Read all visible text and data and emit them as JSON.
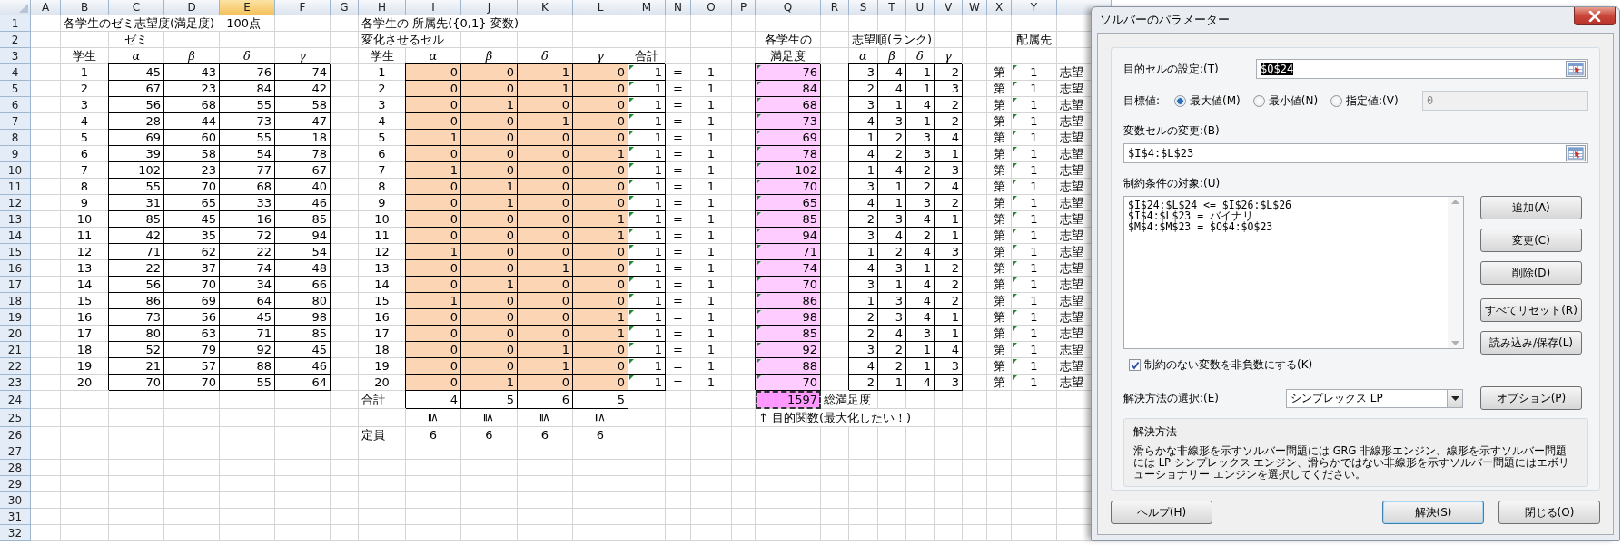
{
  "sheet": {
    "columns": [
      {
        "label": "A",
        "selected": false
      },
      {
        "label": "B",
        "selected": false
      },
      {
        "label": "C",
        "selected": false
      },
      {
        "label": "D",
        "selected": false
      },
      {
        "label": "E",
        "selected": true
      },
      {
        "label": "F",
        "selected": false
      },
      {
        "label": "G",
        "selected": false
      },
      {
        "label": "H",
        "selected": false
      },
      {
        "label": "I",
        "selected": false
      },
      {
        "label": "J",
        "selected": false
      },
      {
        "label": "K",
        "selected": false
      },
      {
        "label": "L",
        "selected": false
      },
      {
        "label": "M",
        "selected": false
      },
      {
        "label": "N",
        "selected": false
      },
      {
        "label": "O",
        "selected": false
      },
      {
        "label": "P",
        "selected": false
      },
      {
        "label": "Q",
        "selected": false
      },
      {
        "label": "R",
        "selected": false
      },
      {
        "label": "S",
        "selected": false
      },
      {
        "label": "T",
        "selected": false
      },
      {
        "label": "U",
        "selected": false
      },
      {
        "label": "V",
        "selected": false
      },
      {
        "label": "W",
        "selected": false
      },
      {
        "label": "X",
        "selected": false
      },
      {
        "label": "Y",
        "selected": false
      },
      {
        "selected": false
      }
    ],
    "rows": [
      "1",
      "2",
      "3",
      "4",
      "5",
      "6",
      "7",
      "8",
      "9",
      "10",
      "11",
      "12",
      "13",
      "14",
      "15",
      "16",
      "17",
      "18",
      "19",
      "20",
      "21",
      "22",
      "23",
      "24",
      "25",
      "26",
      "27",
      "28",
      "29",
      "30",
      "31",
      "32"
    ],
    "preferences": {
      "title": "各学生のゼミ志望度(満足度)　100点",
      "group": "ゼミ",
      "student_header": "学生",
      "zemi": [
        "α",
        "β",
        "δ",
        "γ"
      ],
      "rows": [
        {
          "student": "1",
          "scores": [
            "45",
            "43",
            "76",
            "74"
          ]
        },
        {
          "student": "2",
          "scores": [
            "67",
            "23",
            "84",
            "42"
          ]
        },
        {
          "student": "3",
          "scores": [
            "56",
            "68",
            "55",
            "58"
          ]
        },
        {
          "student": "4",
          "scores": [
            "28",
            "44",
            "73",
            "47"
          ]
        },
        {
          "student": "5",
          "scores": [
            "69",
            "60",
            "55",
            "18"
          ]
        },
        {
          "student": "6",
          "scores": [
            "39",
            "58",
            "54",
            "78"
          ]
        },
        {
          "student": "7",
          "scores": [
            "102",
            "23",
            "77",
            "67"
          ]
        },
        {
          "student": "8",
          "scores": [
            "55",
            "70",
            "68",
            "40"
          ]
        },
        {
          "student": "9",
          "scores": [
            "31",
            "65",
            "33",
            "46"
          ]
        },
        {
          "student": "10",
          "scores": [
            "85",
            "45",
            "16",
            "85"
          ]
        },
        {
          "student": "11",
          "scores": [
            "42",
            "35",
            "72",
            "94"
          ]
        },
        {
          "student": "12",
          "scores": [
            "71",
            "62",
            "22",
            "54"
          ]
        },
        {
          "student": "13",
          "scores": [
            "22",
            "37",
            "74",
            "48"
          ]
        },
        {
          "student": "14",
          "scores": [
            "56",
            "70",
            "34",
            "66"
          ]
        },
        {
          "student": "15",
          "scores": [
            "86",
            "69",
            "64",
            "80"
          ]
        },
        {
          "student": "16",
          "scores": [
            "73",
            "56",
            "45",
            "98"
          ]
        },
        {
          "student": "17",
          "scores": [
            "80",
            "63",
            "71",
            "85"
          ]
        },
        {
          "student": "18",
          "scores": [
            "52",
            "79",
            "92",
            "45"
          ]
        },
        {
          "student": "19",
          "scores": [
            "21",
            "57",
            "88",
            "46"
          ]
        },
        {
          "student": "20",
          "scores": [
            "70",
            "70",
            "55",
            "64"
          ]
        }
      ]
    },
    "assignment": {
      "title": "各学生の 所属先({0,1}-変数)",
      "subtitle": "変化させるセル",
      "student_header": "学生",
      "zemi": [
        "α",
        "β",
        "δ",
        "γ"
      ],
      "total_header": "合計",
      "total_flagged": true,
      "rows": [
        {
          "student": "1",
          "vars": [
            "0",
            "0",
            "1",
            "0"
          ],
          "total": "1",
          "relation": "=",
          "rhs": "1"
        },
        {
          "student": "2",
          "vars": [
            "0",
            "0",
            "1",
            "0"
          ],
          "total": "1",
          "relation": "=",
          "rhs": "1"
        },
        {
          "student": "3",
          "vars": [
            "0",
            "1",
            "0",
            "0"
          ],
          "total": "1",
          "relation": "=",
          "rhs": "1"
        },
        {
          "student": "4",
          "vars": [
            "0",
            "0",
            "1",
            "0"
          ],
          "total": "1",
          "relation": "=",
          "rhs": "1"
        },
        {
          "student": "5",
          "vars": [
            "1",
            "0",
            "0",
            "0"
          ],
          "total": "1",
          "relation": "=",
          "rhs": "1"
        },
        {
          "student": "6",
          "vars": [
            "0",
            "0",
            "0",
            "1"
          ],
          "total": "1",
          "relation": "=",
          "rhs": "1"
        },
        {
          "student": "7",
          "vars": [
            "1",
            "0",
            "0",
            "0"
          ],
          "total": "1",
          "relation": "=",
          "rhs": "1"
        },
        {
          "student": "8",
          "vars": [
            "0",
            "1",
            "0",
            "0"
          ],
          "total": "1",
          "relation": "=",
          "rhs": "1"
        },
        {
          "student": "9",
          "vars": [
            "0",
            "1",
            "0",
            "0"
          ],
          "total": "1",
          "relation": "=",
          "rhs": "1"
        },
        {
          "student": "10",
          "vars": [
            "0",
            "0",
            "0",
            "1"
          ],
          "total": "1",
          "relation": "=",
          "rhs": "1"
        },
        {
          "student": "11",
          "vars": [
            "0",
            "0",
            "0",
            "1"
          ],
          "total": "1",
          "relation": "=",
          "rhs": "1"
        },
        {
          "student": "12",
          "vars": [
            "1",
            "0",
            "0",
            "0"
          ],
          "total": "1",
          "relation": "=",
          "rhs": "1"
        },
        {
          "student": "13",
          "vars": [
            "0",
            "0",
            "1",
            "0"
          ],
          "total": "1",
          "relation": "=",
          "rhs": "1"
        },
        {
          "student": "14",
          "vars": [
            "0",
            "1",
            "0",
            "0"
          ],
          "total": "1",
          "relation": "=",
          "rhs": "1"
        },
        {
          "student": "15",
          "vars": [
            "1",
            "0",
            "0",
            "0"
          ],
          "total": "1",
          "relation": "=",
          "rhs": "1"
        },
        {
          "student": "16",
          "vars": [
            "0",
            "0",
            "0",
            "1"
          ],
          "total": "1",
          "relation": "=",
          "rhs": "1"
        },
        {
          "student": "17",
          "vars": [
            "0",
            "0",
            "0",
            "1"
          ],
          "total": "1",
          "relation": "=",
          "rhs": "1"
        },
        {
          "student": "18",
          "vars": [
            "0",
            "0",
            "1",
            "0"
          ],
          "total": "1",
          "relation": "=",
          "rhs": "1"
        },
        {
          "student": "19",
          "vars": [
            "0",
            "0",
            "1",
            "0"
          ],
          "total": "1",
          "relation": "=",
          "rhs": "1"
        },
        {
          "student": "20",
          "vars": [
            "0",
            "1",
            "0",
            "0"
          ],
          "total": "1",
          "relation": "=",
          "rhs": "1"
        }
      ],
      "total_label": "合計",
      "totals": [
        "4",
        "5",
        "6",
        "5"
      ],
      "relations": [
        "≦",
        "≦",
        "≦",
        "≦"
      ],
      "capacity_label": "定員",
      "capacities": [
        "6",
        "6",
        "6",
        "6"
      ]
    },
    "satisfaction": {
      "header": [
        "各学生の",
        "満足度"
      ],
      "flagged": true,
      "values": [
        "76",
        "84",
        "68",
        "73",
        "69",
        "78",
        "102",
        "70",
        "65",
        "85",
        "94",
        "71",
        "74",
        "70",
        "86",
        "98",
        "85",
        "92",
        "88",
        "70"
      ],
      "total": "1597",
      "total_marquee": true,
      "total_label": "総満足度",
      "note": "↑ 目的関数(最大化したい！)"
    },
    "ranking": {
      "title": "志望順(ランク)",
      "zemi": [
        "α",
        "β",
        "δ",
        "γ"
      ],
      "rows": [
        [
          "3",
          "4",
          "1",
          "2"
        ],
        [
          "2",
          "4",
          "1",
          "3"
        ],
        [
          "3",
          "1",
          "4",
          "2"
        ],
        [
          "4",
          "3",
          "1",
          "2"
        ],
        [
          "1",
          "2",
          "3",
          "4"
        ],
        [
          "4",
          "2",
          "3",
          "1"
        ],
        [
          "1",
          "4",
          "2",
          "3"
        ],
        [
          "3",
          "1",
          "2",
          "4"
        ],
        [
          "4",
          "1",
          "3",
          "2"
        ],
        [
          "2",
          "3",
          "4",
          "1"
        ],
        [
          "3",
          "4",
          "2",
          "1"
        ],
        [
          "1",
          "2",
          "4",
          "3"
        ],
        [
          "4",
          "3",
          "1",
          "2"
        ],
        [
          "3",
          "1",
          "4",
          "2"
        ],
        [
          "1",
          "3",
          "4",
          "2"
        ],
        [
          "2",
          "3",
          "4",
          "1"
        ],
        [
          "2",
          "4",
          "3",
          "1"
        ],
        [
          "3",
          "2",
          "1",
          "4"
        ],
        [
          "4",
          "2",
          "1",
          "3"
        ],
        [
          "2",
          "1",
          "4",
          "3"
        ]
      ]
    },
    "placement": {
      "title": "配属先",
      "flagged": true,
      "rows": [
        {
          "prefix": "第",
          "value": "1",
          "suffix": "志望"
        },
        {
          "prefix": "第",
          "value": "1",
          "suffix": "志望"
        },
        {
          "prefix": "第",
          "value": "1",
          "suffix": "志望"
        },
        {
          "prefix": "第",
          "value": "1",
          "suffix": "志望"
        },
        {
          "prefix": "第",
          "value": "1",
          "suffix": "志望"
        },
        {
          "prefix": "第",
          "value": "1",
          "suffix": "志望"
        },
        {
          "prefix": "第",
          "value": "1",
          "suffix": "志望"
        },
        {
          "prefix": "第",
          "value": "1",
          "suffix": "志望"
        },
        {
          "prefix": "第",
          "value": "1",
          "suffix": "志望"
        },
        {
          "prefix": "第",
          "value": "1",
          "suffix": "志望"
        },
        {
          "prefix": "第",
          "value": "1",
          "suffix": "志望"
        },
        {
          "prefix": "第",
          "value": "1",
          "suffix": "志望"
        },
        {
          "prefix": "第",
          "value": "1",
          "suffix": "志望"
        },
        {
          "prefix": "第",
          "value": "1",
          "suffix": "志望"
        },
        {
          "prefix": "第",
          "value": "1",
          "suffix": "志望"
        },
        {
          "prefix": "第",
          "value": "1",
          "suffix": "志望"
        },
        {
          "prefix": "第",
          "value": "1",
          "suffix": "志望"
        },
        {
          "prefix": "第",
          "value": "1",
          "suffix": "志望"
        },
        {
          "prefix": "第",
          "value": "1",
          "suffix": "志望"
        },
        {
          "prefix": "第",
          "value": "1",
          "suffix": "志望"
        }
      ]
    }
  },
  "dialog": {
    "title": "ソルバーのパラメーター",
    "objective": {
      "label": "目的セルの設定:(T)",
      "value": "$Q$24",
      "selected": true
    },
    "goal": {
      "label": "目標値:",
      "options": [
        {
          "label": "最大値(M)",
          "selected": true
        },
        {
          "label": "最小値(N)",
          "selected": false
        },
        {
          "label": "指定値:(V)",
          "selected": false
        }
      ],
      "value": "0",
      "disabled": true
    },
    "variables": {
      "label": "変数セルの変更:(B)",
      "value": "$I$4:$L$23"
    },
    "constraints": {
      "label": "制約条件の対象:(U)",
      "items": [
        "$I$24:$L$24 <= $I$26:$L$26",
        "$I$4:$L$23 = バイナリ",
        "$M$4:$M$23 = $O$4:$O$23"
      ]
    },
    "side_buttons": [
      "追加(A)",
      "変更(C)",
      "削除(D)",
      "すべてリセット(R)",
      "読み込み/保存(L)"
    ],
    "nonnegative": {
      "label": "制約のない変数を非負数にする(K)",
      "checked": true
    },
    "method": {
      "label": "解決方法の選択:(E)",
      "value": "シンプレックス LP"
    },
    "options_button": "オプション(P)",
    "method_help": {
      "title": "解決方法",
      "text": "滑らかな非線形を示すソルバー問題には GRG 非線形エンジン、線形を示すソルバー問題には LP シンプレックス エンジン、滑らかではない非線形を示すソルバー問題にはエボリューショナリー エンジンを選択してください。"
    },
    "footer_buttons": [
      {
        "label": "ヘルプ(H)",
        "default": false
      },
      {
        "label": "解決(S)",
        "default": true
      },
      {
        "label": "閉じる(O)",
        "default": false
      }
    ]
  }
}
